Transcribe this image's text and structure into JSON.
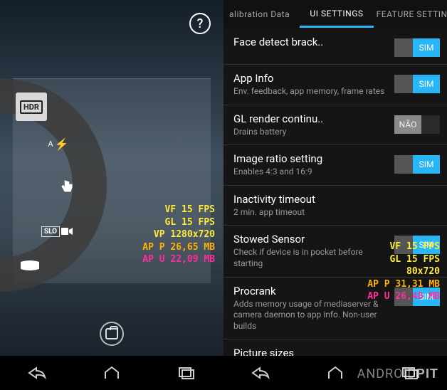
{
  "left": {
    "help_label": "?",
    "arc": {
      "hdr": "HDR",
      "flash_label": "A",
      "slo_label": "SLO"
    },
    "stats": {
      "vf": "VF 15 FPS",
      "gl": "GL 15 FPS",
      "vp": "VP 1280x720",
      "ap_p": "AP P 26,65 MB",
      "ap_u": "AP U 22,09 MB"
    }
  },
  "right": {
    "tabs": {
      "calibration": "alibration Data",
      "ui": "UI SETTINGS",
      "feature": "FEATURE SETTIN"
    },
    "toggle_on": "SIM",
    "toggle_off": "NÃO",
    "items": [
      {
        "title": "Face detect brack..",
        "sub": "",
        "state": "on"
      },
      {
        "title": "App Info",
        "sub": "Env. feedback, app memory, frame rates",
        "state": "on"
      },
      {
        "title": "GL render continu..",
        "sub": "Drains battery",
        "state": "off"
      },
      {
        "title": "Image ratio setting",
        "sub": "Enables 4:3 and 16:9",
        "state": "on"
      },
      {
        "title": "Inactivity timeout",
        "sub": "2 min. app timeout",
        "state": "none"
      },
      {
        "title": "Stowed Sensor",
        "sub": "Check if device is in pocket before starting",
        "state": "on"
      },
      {
        "title": "Procrank",
        "sub": "Adds memory usage of mediaserver & camera daemon to app info. Non-user builds",
        "state": "on"
      },
      {
        "title": "Picture sizes",
        "sub": "",
        "state": "none"
      }
    ],
    "stats": {
      "vf": "VF 15 FPS",
      "gl": "GL 15 FPS",
      "vp": "80x720",
      "ap_p": "AP P 31,31 MB",
      "ap_u": "AP U 26,48 MB"
    }
  },
  "watermark": {
    "a": "ANDROID",
    "b": "PIT"
  }
}
